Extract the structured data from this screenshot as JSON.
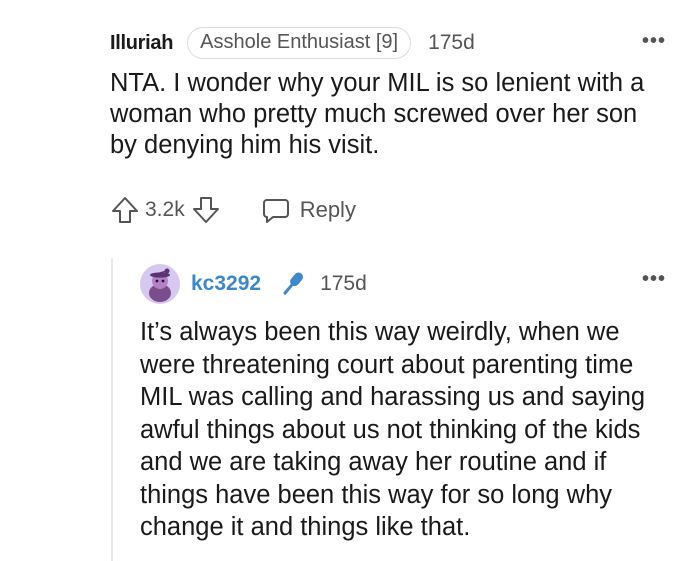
{
  "comment": {
    "username": "Illuriah",
    "flair": "Asshole Enthusiast [9]",
    "timestamp": "175d",
    "more": "•••",
    "body": "NTA. I wonder why your MIL is so lenient with a woman who pretty much screwed over her son by denying him his visit.",
    "score": "3.2k",
    "reply_label": "Reply",
    "icons": {
      "upvote": "upvote-arrow-icon",
      "downvote": "downvote-arrow-icon",
      "reply": "speech-bubble-icon"
    }
  },
  "reply": {
    "username": "kc3292",
    "timestamp": "175d",
    "more": "•••",
    "body": "It’s always been this way weirdly, when we were threatening court about parenting time MIL was calling and harassing us and saying awful things about us not thinking of the kids and we are taking away her routine and if things have been this way for so long why change it and things like that.",
    "icons": {
      "avatar": "snoo-avatar-icon",
      "flair": "microphone-icon"
    }
  },
  "colors": {
    "text": "#1a1a1b",
    "meta": "#555555",
    "reply_username": "#3d88c9",
    "mic": "#3d88c9",
    "avatar_bg": "#d7c8f0",
    "thread_line": "#eaeaea"
  }
}
